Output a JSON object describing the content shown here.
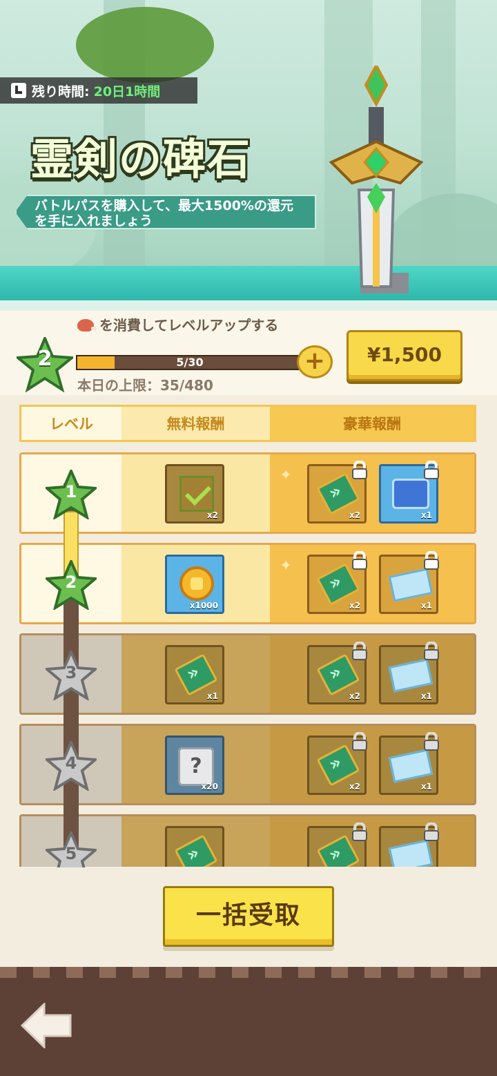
{
  "timer": {
    "label": "残り時間:",
    "value": "20日1時間"
  },
  "title": "霊剣の碑石",
  "subtitle": "バトルパスを購入して、最大1500%の還元を手に入れましょう",
  "level": {
    "current": "2",
    "consume_text": "を消費してレベルアップする",
    "progress_text": "5/30",
    "progress_fraction": 0.167,
    "daily_limit": "本日の上限：35/480",
    "plus": "+"
  },
  "price_button": "¥1,500",
  "table_header": {
    "level": "レベル",
    "free": "無料報酬",
    "premium": "豪華報酬"
  },
  "rows": [
    {
      "level": "1",
      "free_qty": "x2",
      "prem1_qty": "x2",
      "prem2_qty": "x1"
    },
    {
      "level": "2",
      "free_qty": "x1000",
      "prem1_qty": "x2",
      "prem2_qty": "x1"
    },
    {
      "level": "3",
      "free_qty": "x1",
      "prem1_qty": "x2",
      "prem2_qty": "x1"
    },
    {
      "level": "4",
      "free_qty": "x20",
      "prem1_qty": "x2",
      "prem2_qty": "x1"
    },
    {
      "level": "5",
      "free_qty": "",
      "prem1_qty": "",
      "prem2_qty": ""
    }
  ],
  "claim_all_button": "一括受取",
  "colors": {
    "accent_gold": "#f8d94a",
    "timer_green": "#6ff07a",
    "star_green": "#5aa845"
  }
}
